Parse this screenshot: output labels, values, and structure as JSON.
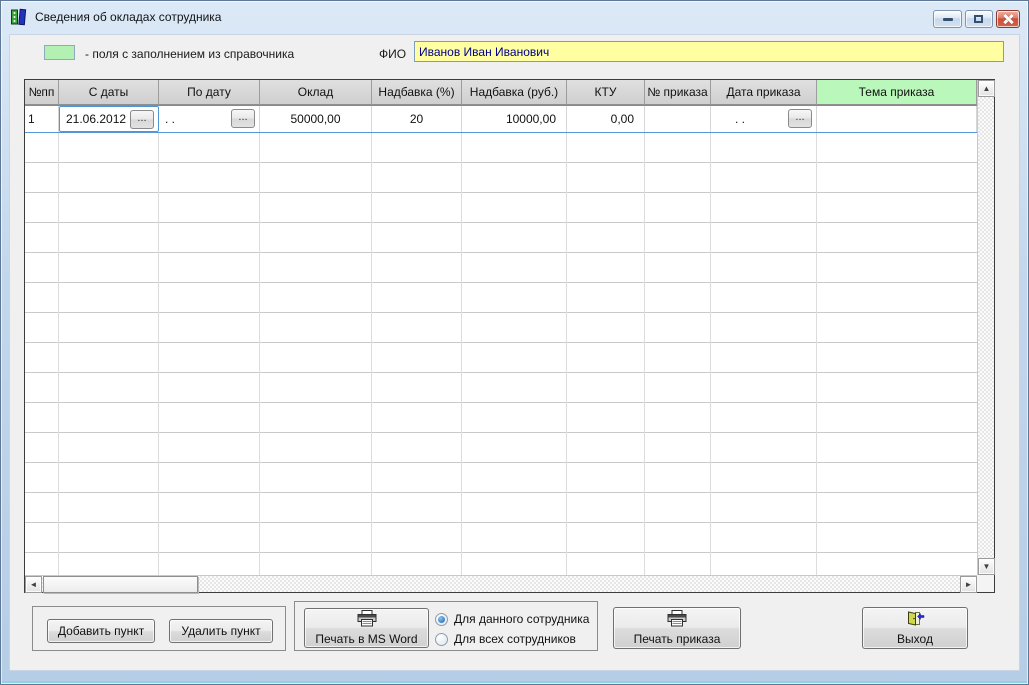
{
  "window": {
    "title": "Сведения об окладах сотрудника"
  },
  "icons": {
    "app": "books-icon",
    "minimize": "minimize-icon",
    "maximize": "maximize-icon",
    "close": "close-icon",
    "printer": "printer-icon",
    "exit_door": "exit-door-icon",
    "scroll_up": "▲",
    "scroll_down": "▼",
    "scroll_left": "◄",
    "scroll_right": "►"
  },
  "colors": {
    "legend_green": "#b3f1b3",
    "header_green": "#baf7ba",
    "field_yellow": "#ffffa1",
    "selection_blue": "#5596d8",
    "fio_text_navy": "#00008b"
  },
  "legend": {
    "label": "- поля с заполнением из справочника"
  },
  "fio": {
    "label": "ФИО",
    "value": "Иванов Иван Иванович"
  },
  "table": {
    "columns": [
      "№пп",
      "С даты",
      "По дату",
      "Оклад",
      "Надбавка (%)",
      "Надбавка (руб.)",
      "КТУ",
      "№ приказа",
      "Дата приказа",
      "Тема приказа"
    ],
    "ellipsis_button": "...",
    "rows": [
      {
        "num": "1",
        "from_date": "21.06.2012",
        "to_date": ".  .",
        "salary": "50000,00",
        "bonus_percent": "20",
        "bonus_rub": "10000,00",
        "ktu": "0,00",
        "order_number": "",
        "order_date": ".  .",
        "order_theme": ""
      }
    ]
  },
  "footer": {
    "add_button": "Добавить пункт",
    "delete_button": "Удалить пункт",
    "print_word_button": "Печать в MS Word",
    "radio_options": [
      {
        "label": "Для данного сотрудника",
        "selected": true
      },
      {
        "label": "Для всех сотрудников",
        "selected": false
      }
    ],
    "print_order_button": "Печать приказа",
    "exit_button": "Выход"
  }
}
